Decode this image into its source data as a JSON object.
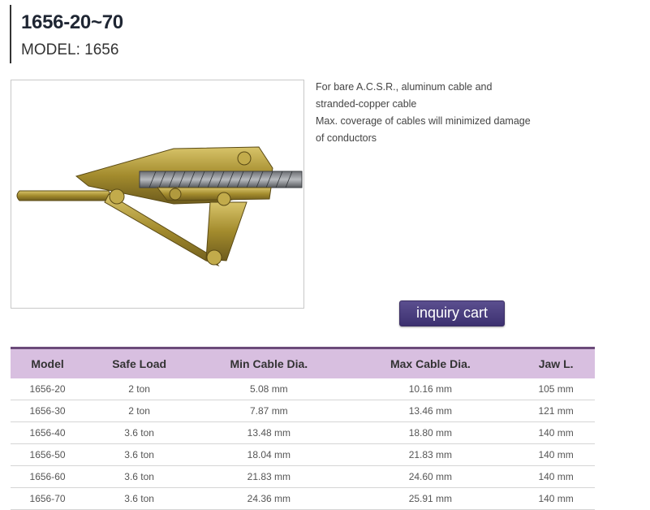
{
  "header": {
    "title": "1656-20~70",
    "model_label": "MODEL",
    "model_value": "1656"
  },
  "description": {
    "lines": [
      "For bare A.C.S.R., aluminum cable and",
      "stranded-copper cable",
      "Max. coverage of cables will minimized damage",
      "of conductors"
    ]
  },
  "buttons": {
    "inquiry_cart": "inquiry cart"
  },
  "spec_table": {
    "headers": [
      "Model",
      "Safe Load",
      "Min Cable Dia.",
      "Max Cable Dia.",
      "Jaw L."
    ],
    "rows": [
      [
        "1656-20",
        "2 ton",
        "5.08 mm",
        "10.16 mm",
        "105 mm"
      ],
      [
        "1656-30",
        "2 ton",
        "7.87 mm",
        "13.46 mm",
        "121 mm"
      ],
      [
        "1656-40",
        "3.6 ton",
        "13.48 mm",
        "18.80 mm",
        "140 mm"
      ],
      [
        "1656-50",
        "3.6 ton",
        "18.04 mm",
        "21.83 mm",
        "140 mm"
      ],
      [
        "1656-60",
        "3.6 ton",
        "21.83 mm",
        "24.60 mm",
        "140 mm"
      ],
      [
        "1656-70",
        "3.6 ton",
        "24.36 mm",
        "25.91 mm",
        "140 mm"
      ]
    ]
  },
  "colors": {
    "accent": "#4a3e7e",
    "table_header": "#d8bfe0",
    "table_header_border": "#6b4a7a"
  }
}
